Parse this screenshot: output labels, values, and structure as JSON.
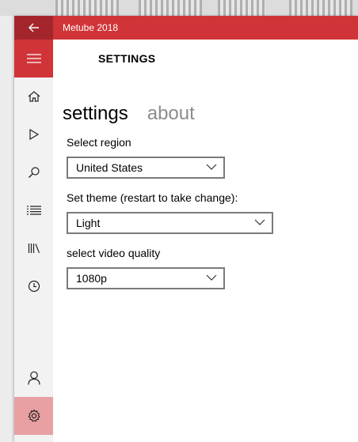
{
  "window": {
    "title": "Metube 2018"
  },
  "page": {
    "title": "SETTINGS"
  },
  "pivot": {
    "tabs": [
      "settings",
      "about"
    ],
    "active": 0
  },
  "settings": {
    "region": {
      "label": "Select region",
      "value": "United States"
    },
    "theme": {
      "label": "Set theme (restart to take change):",
      "value": "Light"
    },
    "quality": {
      "label": "select video quality",
      "value": "1080p"
    }
  },
  "nav": {
    "items": [
      "hamburger-icon",
      "home-icon",
      "play-icon",
      "search-icon",
      "list-icon",
      "library-icon",
      "history-icon",
      "account-icon",
      "settings-icon"
    ]
  },
  "colors": {
    "accent": "#d13438",
    "accent_dark": "#a4262c",
    "selected": "#e8a0a3"
  }
}
